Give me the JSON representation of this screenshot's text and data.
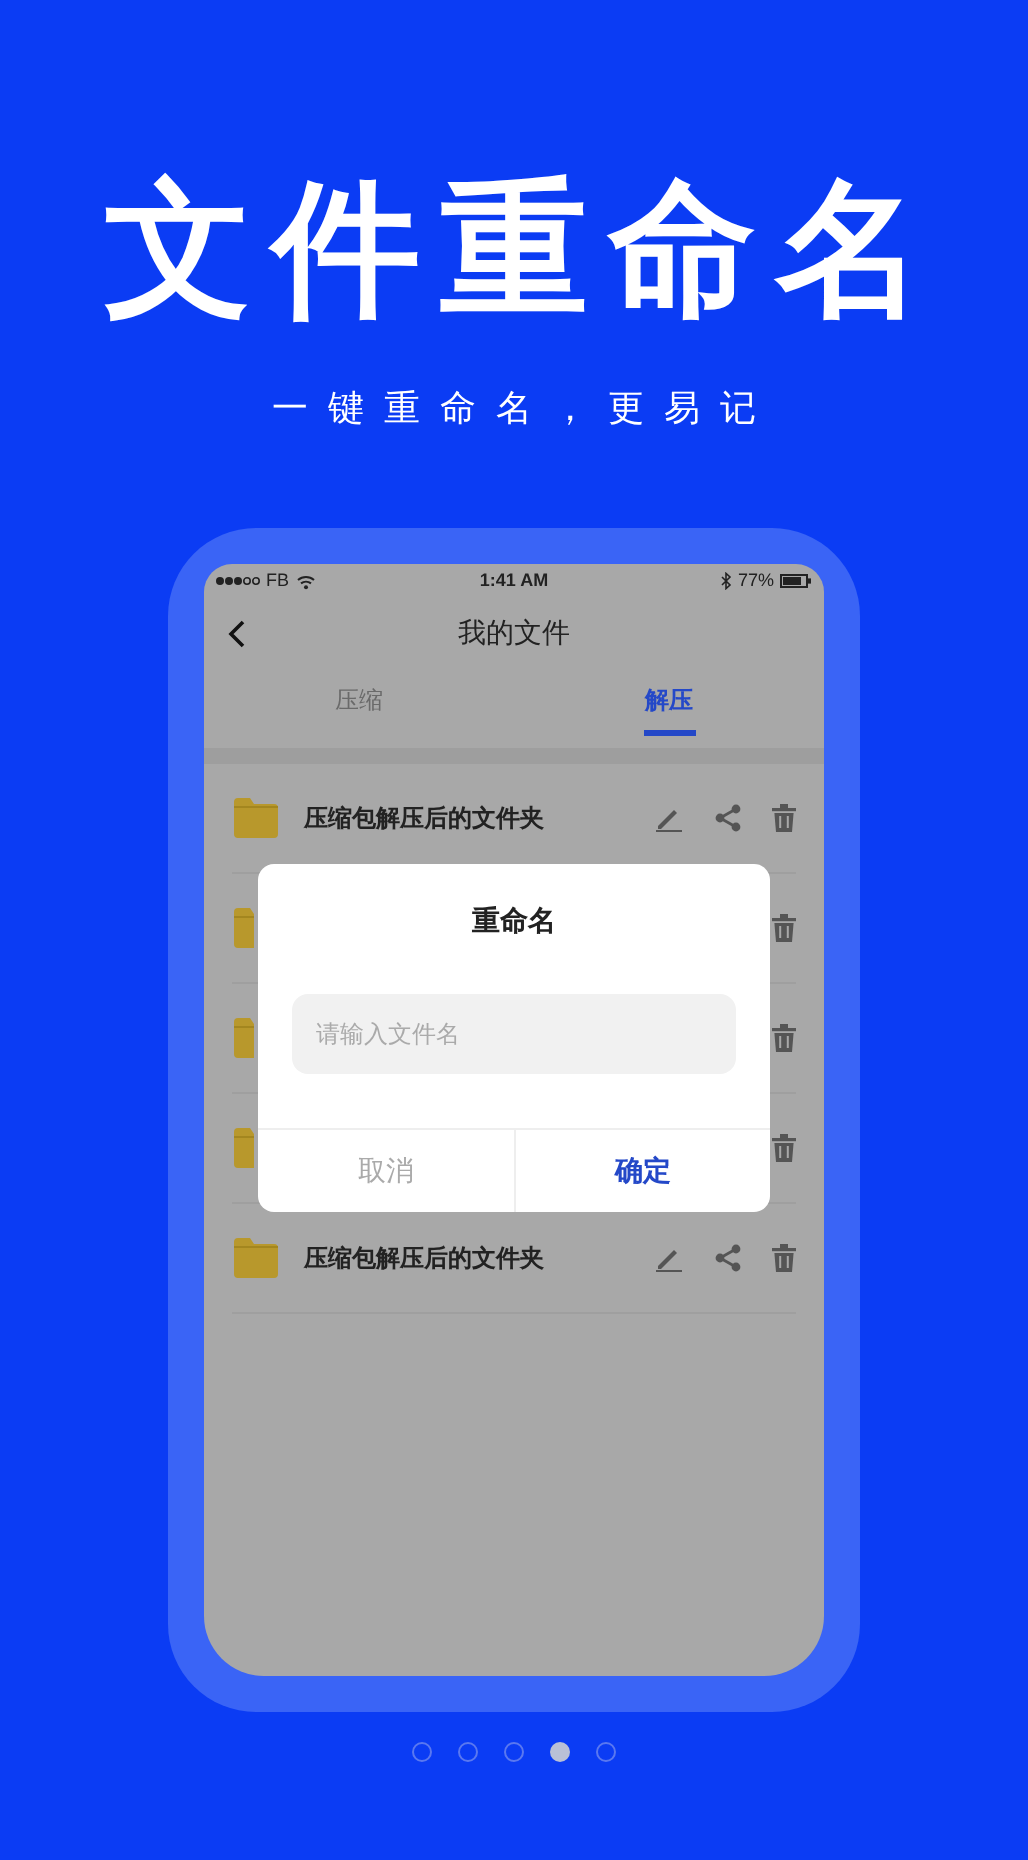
{
  "headline": "文件重命名",
  "subtitle": "一键重命名，更易记",
  "status_bar": {
    "carrier": "FB",
    "time": "1:41 AM",
    "battery": "77%"
  },
  "nav": {
    "title": "我的文件"
  },
  "tabs": [
    {
      "label": "压缩",
      "selected": false
    },
    {
      "label": "解压",
      "selected": true
    }
  ],
  "files": [
    {
      "kind": "full",
      "name": "压缩包解压后的文件夹"
    },
    {
      "kind": "covered"
    },
    {
      "kind": "covered"
    },
    {
      "kind": "covered"
    },
    {
      "kind": "full",
      "name": "压缩包解压后的文件夹"
    }
  ],
  "dialog": {
    "title": "重命名",
    "placeholder": "请输入文件名",
    "cancel": "取消",
    "confirm": "确定"
  },
  "pager": [
    {
      "selected": false
    },
    {
      "selected": false
    },
    {
      "selected": false
    },
    {
      "selected": true
    },
    {
      "selected": false
    }
  ]
}
